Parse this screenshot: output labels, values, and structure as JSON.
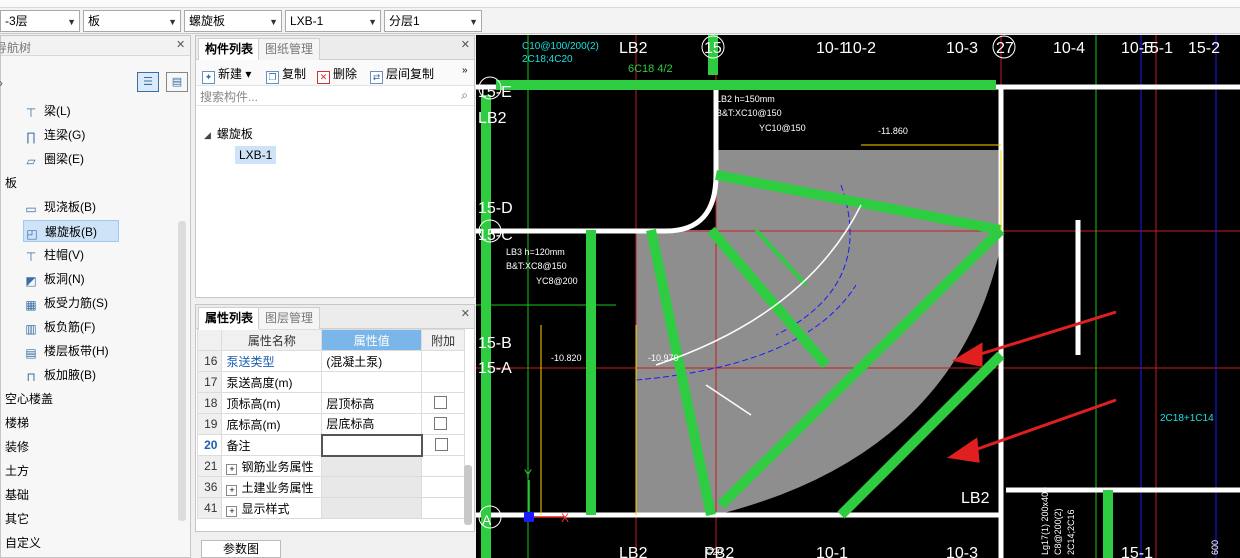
{
  "toolbar": {
    "combos": [
      {
        "value": "-3层"
      },
      {
        "value": "板"
      },
      {
        "value": "螺旋板"
      },
      {
        "value": "LXB-1"
      },
      {
        "value": "分层1"
      }
    ]
  },
  "nav": {
    "title": "导航树",
    "items": [
      {
        "label": "梁(L)",
        "icon": "beam-icon"
      },
      {
        "label": "连梁(G)",
        "icon": "link-beam-icon"
      },
      {
        "label": "圈梁(E)",
        "icon": "ring-beam-icon"
      },
      {
        "label": "板",
        "icon": ""
      },
      {
        "label": "现浇板(B)",
        "icon": "slab-icon"
      },
      {
        "label": "螺旋板(B)",
        "icon": "spiral-slab-icon"
      },
      {
        "label": "柱帽(V)",
        "icon": "column-cap-icon"
      },
      {
        "label": "板洞(N)",
        "icon": "slab-hole-icon"
      },
      {
        "label": "板受力筋(S)",
        "icon": "slab-rebar-icon"
      },
      {
        "label": "板负筋(F)",
        "icon": "negative-rebar-icon"
      },
      {
        "label": "楼层板带(H)",
        "icon": "slab-strip-icon"
      },
      {
        "label": "板加腋(B)",
        "icon": "slab-haunch-icon"
      },
      {
        "label": "空心楼盖",
        "icon": ""
      },
      {
        "label": "楼梯",
        "icon": ""
      },
      {
        "label": "装修",
        "icon": ""
      },
      {
        "label": "土方",
        "icon": ""
      },
      {
        "label": "基础",
        "icon": ""
      },
      {
        "label": "其它",
        "icon": ""
      },
      {
        "label": "自定义",
        "icon": ""
      }
    ]
  },
  "components": {
    "tabs": [
      "构件列表",
      "图纸管理"
    ],
    "buttons": {
      "new": "新建",
      "copy": "复制",
      "delete": "删除",
      "floor_copy": "层间复制"
    },
    "search_placeholder": "搜索构件...",
    "tree_root": "螺旋板",
    "tree_item": "LXB-1"
  },
  "properties": {
    "tabs": [
      "属性列表",
      "图层管理"
    ],
    "headers": {
      "name": "属性名称",
      "value": "属性值",
      "extra": "附加"
    },
    "rows": [
      {
        "num": "16",
        "name": "泵送类型",
        "value": "(混凝土泵)",
        "check": false,
        "link": true
      },
      {
        "num": "17",
        "name": "泵送高度(m)",
        "value": "",
        "check": false
      },
      {
        "num": "18",
        "name": "顶标高(m)",
        "value": "层顶标高",
        "check": true
      },
      {
        "num": "19",
        "name": "底标高(m)",
        "value": "层底标高",
        "check": true
      },
      {
        "num": "20",
        "name": "备注",
        "value": "",
        "check": true,
        "selected": true
      },
      {
        "num": "21",
        "name": "钢筋业务属性",
        "value": "",
        "expand": true
      },
      {
        "num": "36",
        "name": "土建业务属性",
        "value": "",
        "expand": true
      },
      {
        "num": "41",
        "name": "显示样式",
        "value": "",
        "expand": true
      }
    ],
    "bottom_tab": "参数图"
  },
  "cad": {
    "axis_top": [
      "LB2",
      "15",
      "10-1",
      "10-2",
      "10-3",
      "27",
      "10-4",
      "10-5",
      "15-1",
      "15-2"
    ],
    "axis_bottom": [
      "LB2",
      "PB2",
      "10-1",
      "10-3",
      "15-1"
    ],
    "axis_left": [
      "15-E",
      "LB2",
      "15-D",
      "15-C",
      "15-B",
      "15-A"
    ],
    "labels": {
      "top_rebar": "C10@100/200(2)",
      "top_rebar2": "2C18;4C20",
      "lb2_note": "6C18 4/2",
      "lb2_h": "LB2 h=150mm",
      "lb2_bt": "B&T:XC10@150",
      "lb2_yc": "YC10@150",
      "lb3_h": "LB3 h=120mm",
      "lb3_bt": "B&T:XC8@150",
      "lb3_yc": "YC8@200",
      "elev1": "-11.860",
      "elev2": "-10.820",
      "elev3": "-10.970",
      "right_rebar": "2C18+1C14",
      "lb2_bottom": "LB2",
      "lg17": "Lg17(1) 200x400",
      "lg17b": "C8@200(2)",
      "lg17c": "2C14;2C16",
      "axis_x": "X",
      "axis_y": "Y",
      "axis_a": "A",
      "c20": "C20",
      "val600": "600"
    }
  }
}
